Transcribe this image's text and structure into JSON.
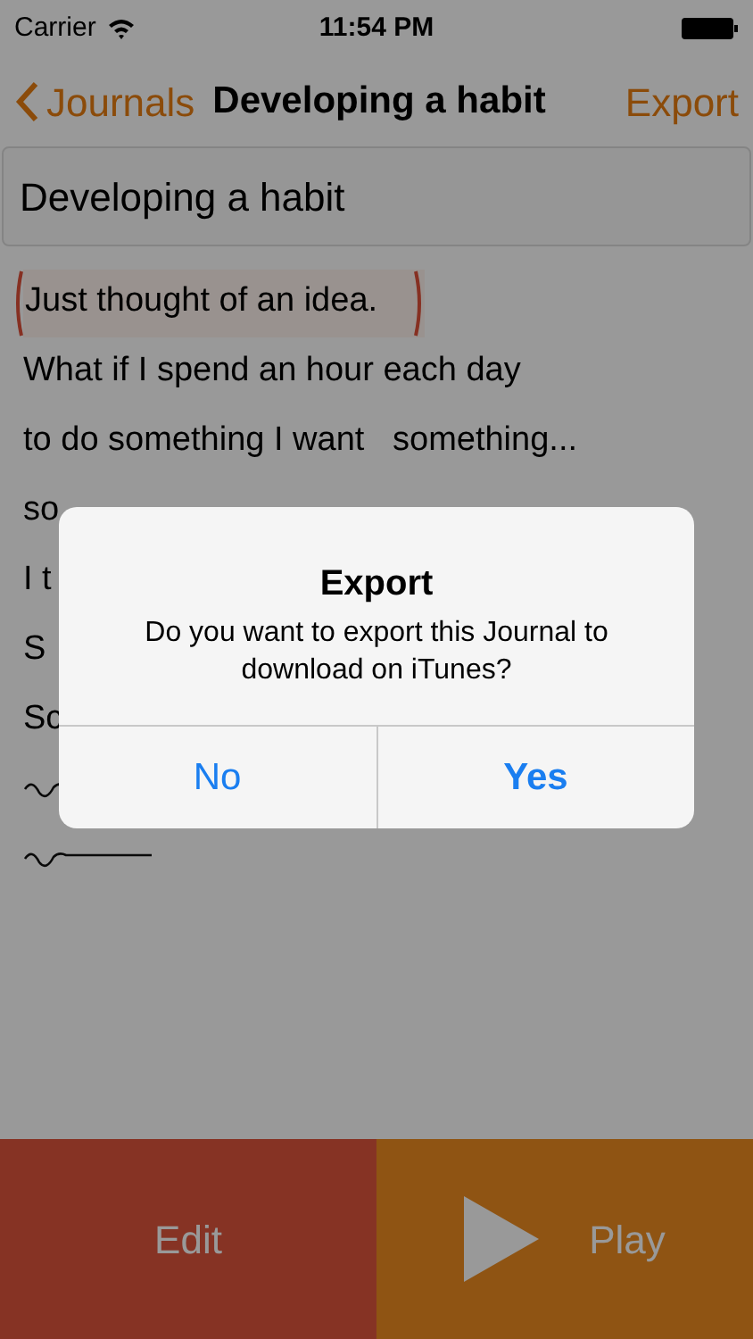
{
  "status_bar": {
    "carrier": "Carrier",
    "time": "11:54 PM"
  },
  "nav": {
    "back": "Journals",
    "title": "Developing a habit",
    "action": "Export"
  },
  "title_field": {
    "value": "Developing a habit"
  },
  "lines": [
    {
      "kind": "text",
      "text": "Just thought of an idea.",
      "selected": true
    },
    {
      "kind": "text",
      "text": "What if I spend an hour each day",
      "selected": false
    },
    {
      "kind": "text",
      "text": "to do something I want   something...",
      "selected": false
    },
    {
      "kind": "text",
      "text": "so",
      "selected": false
    },
    {
      "kind": "text",
      "text": "I t",
      "selected": false
    },
    {
      "kind": "text",
      "text": "S",
      "selected": false
    },
    {
      "kind": "text",
      "text": "Sc",
      "selected": false
    },
    {
      "kind": "squiggle"
    },
    {
      "kind": "squiggle"
    }
  ],
  "bottom_bar": {
    "edit": "Edit",
    "play": "Play"
  },
  "dialog": {
    "title": "Export",
    "message": "Do you want to export this Journal to download on iTunes?",
    "buttons": [
      {
        "label": "No",
        "bold": false
      },
      {
        "label": "Yes",
        "bold": true
      }
    ]
  }
}
